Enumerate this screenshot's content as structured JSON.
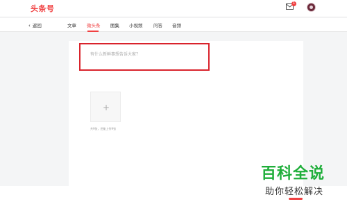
{
  "header": {
    "logo": "头条号",
    "mail_badge": "1",
    "icons": {
      "mail": "mail-icon",
      "avatar": "avatar"
    }
  },
  "tabbar": {
    "back_label": "返回",
    "tabs": [
      {
        "label": "文章",
        "active": false
      },
      {
        "label": "微头条",
        "active": true
      },
      {
        "label": "图集",
        "active": false
      },
      {
        "label": "小视频",
        "active": false
      },
      {
        "label": "问答",
        "active": false
      },
      {
        "label": "音频",
        "active": false
      }
    ]
  },
  "composer": {
    "placeholder": "有什么新鲜事想告诉大家？"
  },
  "upload": {
    "hint": "共9张，还能上传9张"
  },
  "watermark": {
    "title": "百科全说",
    "subtitle": "助你轻松解决"
  },
  "colors": {
    "brand": "#f04142",
    "highlight_box": "#d9232c",
    "watermark_green": "#1fae3a"
  }
}
